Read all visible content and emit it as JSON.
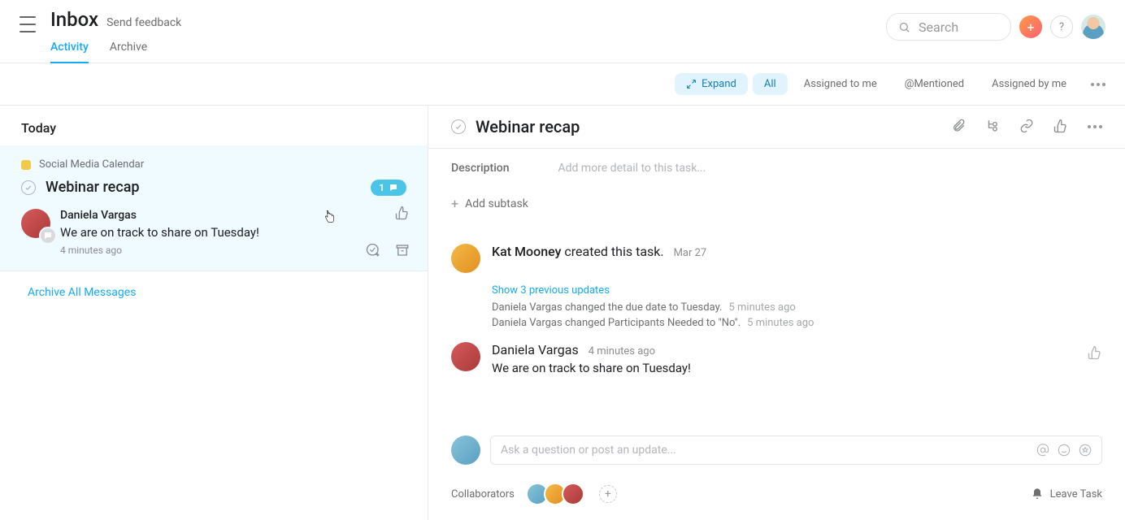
{
  "header": {
    "title": "Inbox",
    "feedback": "Send feedback",
    "tabs": {
      "activity": "Activity",
      "archive": "Archive"
    },
    "search_placeholder": "Search"
  },
  "filters": {
    "expand": "Expand",
    "all": "All",
    "assigned_to_me": "Assigned to me",
    "mentioned": "@Mentioned",
    "assigned_by_me": "Assigned by me"
  },
  "left": {
    "section": "Today",
    "card": {
      "project": "Social Media Calendar",
      "task": "Webinar recap",
      "badge_count": "1",
      "author": "Daniela Vargas",
      "message": "We are on track to share on Tuesday!",
      "time": "4 minutes ago"
    },
    "archive_all": "Archive All Messages"
  },
  "task": {
    "title": "Webinar recap",
    "desc_label": "Description",
    "desc_placeholder": "Add more detail to this task...",
    "add_subtask": "Add subtask",
    "created": {
      "who": "Kat Mooney",
      "action": " created this task.",
      "date": "Mar 27"
    },
    "show_prev": "Show 3 previous updates",
    "changes": [
      {
        "who": "Daniela Vargas",
        "text": " changed the due date to Tuesday.",
        "time": "5 minutes ago"
      },
      {
        "who": "Daniela Vargas",
        "text": " changed Participants Needed to \"No\".",
        "time": "5 minutes ago"
      }
    ],
    "comment": {
      "who": "Daniela Vargas",
      "time": "4 minutes ago",
      "text": "We are on track to share on Tuesday!"
    },
    "compose_placeholder": "Ask a question or post an update...",
    "collab_label": "Collaborators",
    "leave": "Leave Task"
  }
}
